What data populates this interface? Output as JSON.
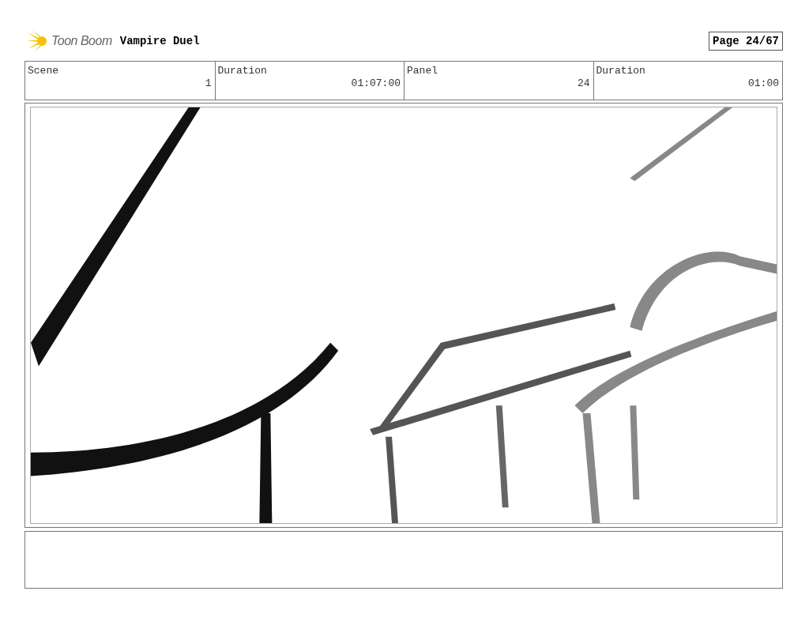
{
  "header": {
    "logo": "Toon Boom",
    "title": "Vampire Duel",
    "page": "Page 24/67"
  },
  "info": {
    "columns": [
      "Scene",
      "Duration",
      "Panel",
      "Duration"
    ],
    "cells": [
      "1",
      "01:07:00",
      "24",
      "01:00"
    ]
  }
}
